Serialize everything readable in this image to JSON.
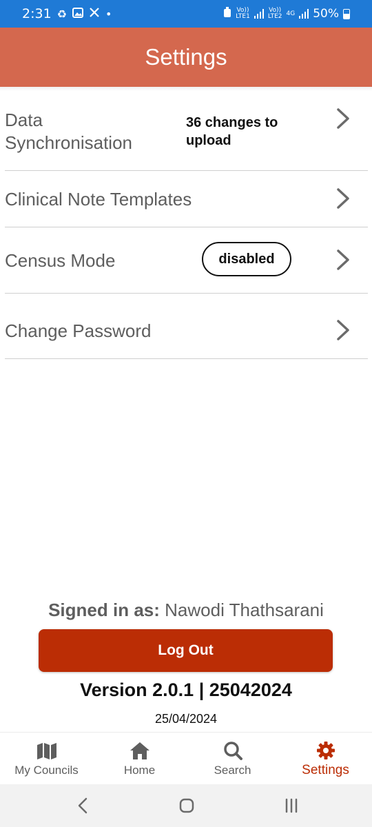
{
  "status_bar": {
    "time": "2:31",
    "left_icons": [
      "sync-icon",
      "image-icon",
      "x-logo-icon",
      "dot-icon"
    ],
    "sim1_label_top": "Vo))",
    "sim1_label_bottom": "LTE1",
    "sim2_label_top": "Vo))",
    "sim2_label_bottom": "LTE2",
    "network_type": "4G",
    "battery_percent": "50%"
  },
  "header": {
    "title": "Settings"
  },
  "settings": {
    "data_sync": {
      "label_line1": "Data",
      "label_line2": "Synchronisation",
      "status_line1": "36 changes to",
      "status_line2": "upload"
    },
    "clinical_templates": {
      "label": "Clinical Note Templates"
    },
    "census_mode": {
      "label": "Census Mode",
      "value": "disabled"
    },
    "change_password": {
      "label": "Change Password"
    }
  },
  "account": {
    "signed_in_label": "Signed in as:",
    "user_name": "Nawodi Thathsarani",
    "logout_label": "Log Out",
    "version_text": "Version 2.0.1 | 25042024",
    "date_text": "25/04/2024"
  },
  "tabs": [
    {
      "label": "My Councils",
      "icon": "map-icon",
      "active": false
    },
    {
      "label": "Home",
      "icon": "home-icon",
      "active": false
    },
    {
      "label": "Search",
      "icon": "search-icon",
      "active": false
    },
    {
      "label": "Settings",
      "icon": "gear-icon",
      "active": true
    }
  ],
  "colors": {
    "status_bar": "#1f7ad6",
    "header": "#d4684e",
    "logout_button": "#bb2d05",
    "active_tab": "#bb2d05"
  }
}
